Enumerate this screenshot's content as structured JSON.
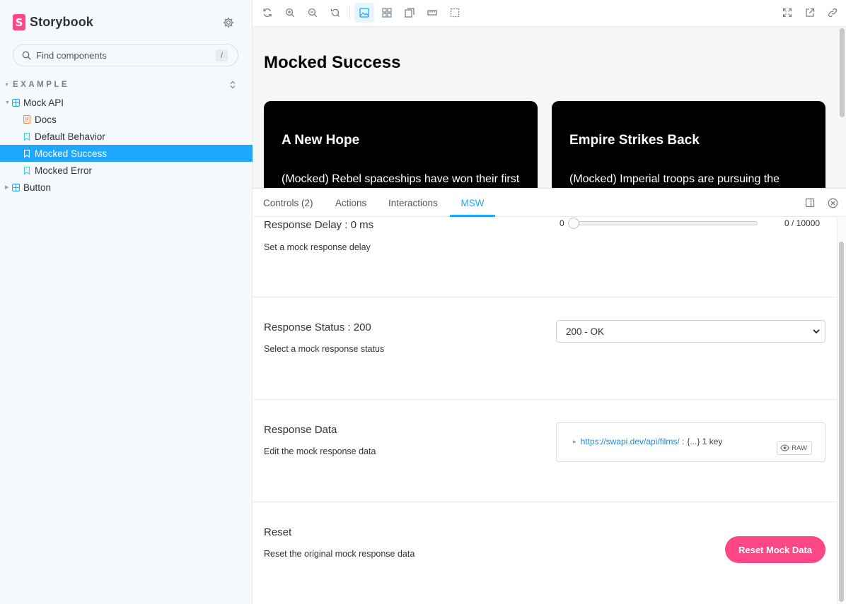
{
  "sidebar": {
    "brand": {
      "logo_letter": "S",
      "name": "Storybook",
      "accent": "#ff4785"
    },
    "settings_icon": "gear-icon",
    "search": {
      "placeholder": "Find components",
      "shortcut": "/"
    },
    "section": {
      "label": "EXAMPLE"
    },
    "tree": [
      {
        "label": "Mock API",
        "icon": "component-icon",
        "type": "component",
        "expanded": true
      },
      {
        "label": "Docs",
        "icon": "document-icon",
        "type": "doc"
      },
      {
        "label": "Default Behavior",
        "icon": "bookmark-icon",
        "type": "story"
      },
      {
        "label": "Mocked Success",
        "icon": "bookmark-icon",
        "type": "story",
        "selected": true
      },
      {
        "label": "Mocked Error",
        "icon": "bookmark-icon",
        "type": "story"
      },
      {
        "label": "Button",
        "icon": "component-icon",
        "type": "component",
        "expanded": false
      }
    ],
    "selected_color": "#1ea7fd"
  },
  "toolbar": {
    "left_tools": [
      "reload-icon",
      "zoom-in-icon",
      "zoom-out-icon",
      "zoom-reset-icon",
      "background-icon",
      "grid-icon",
      "viewport-icon",
      "measure-icon",
      "outline-icon"
    ],
    "right_tools": [
      "fullscreen-icon",
      "open-new-tab-icon",
      "copy-link-icon"
    ]
  },
  "canvas": {
    "title": "Mocked Success",
    "films": [
      {
        "title": "A New Hope",
        "crawl": "(Mocked) Rebel spaceships have won their first victory against the evil Galactic Empire."
      },
      {
        "title": "Empire Strikes Back",
        "crawl": "(Mocked) Imperial troops are pursuing the Rebel forces across the galaxy."
      }
    ]
  },
  "panel": {
    "tabs": [
      {
        "label": "Controls (2)"
      },
      {
        "label": "Actions"
      },
      {
        "label": "Interactions"
      },
      {
        "label": "MSW",
        "active": true
      }
    ],
    "rows": {
      "delay": {
        "title": "Response Delay : 0 ms",
        "description": "Set a mock response delay",
        "min_label": "0",
        "value_label": "0 / 10000",
        "value": 0,
        "max": 10000
      },
      "status": {
        "title": "Response Status : 200",
        "description": "Select a mock response status",
        "selected": "200 - OK"
      },
      "data": {
        "title": "Response Data",
        "description": "Edit the mock response data",
        "json_key": "https://swapi.dev/api/films/ :",
        "json_meta": "{...} 1 key",
        "raw_label": "RAW"
      },
      "reset": {
        "title": "Reset",
        "description": "Reset the original mock response data",
        "button_label": "Reset Mock Data"
      }
    }
  }
}
